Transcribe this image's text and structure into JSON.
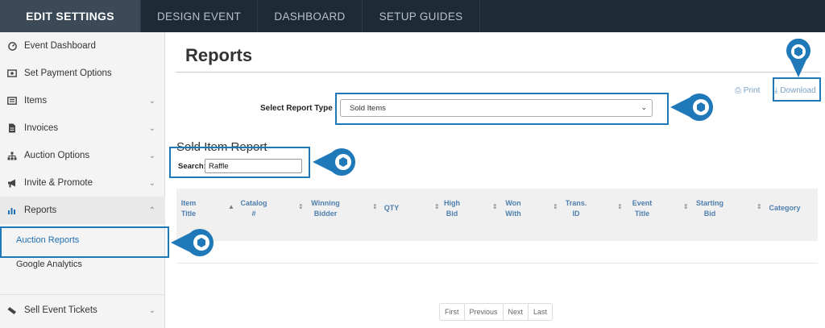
{
  "topnav": {
    "tabs": [
      {
        "label": "EDIT SETTINGS",
        "active": true
      },
      {
        "label": "DESIGN EVENT",
        "active": false
      },
      {
        "label": "DASHBOARD",
        "active": false
      },
      {
        "label": "SETUP GUIDES",
        "active": false
      }
    ]
  },
  "sidebar": {
    "items": [
      {
        "label": "Event Dashboard",
        "icon": "dashboard-icon"
      },
      {
        "label": "Set Payment Options",
        "icon": "money-icon"
      },
      {
        "label": "Items",
        "icon": "list-icon"
      },
      {
        "label": "Invoices",
        "icon": "document-icon"
      },
      {
        "label": "Auction Options",
        "icon": "sitemap-icon"
      },
      {
        "label": "Invite & Promote",
        "icon": "bullhorn-icon"
      },
      {
        "label": "Reports",
        "icon": "bar-chart-icon"
      },
      {
        "label": "Sell Event Tickets",
        "icon": "ticket-icon"
      }
    ],
    "sub_items": [
      {
        "label": "Auction Reports"
      },
      {
        "label": "Google Analytics"
      }
    ]
  },
  "main": {
    "title": "Reports",
    "print_label": "Print",
    "download_label": "Download",
    "report_type_label": "Select Report Type",
    "report_type_value": "Sold Items",
    "report_heading": "Sold Item Report",
    "search_label": "Search:",
    "search_value": "Raffle",
    "columns": [
      {
        "l1": "Item",
        "l2": "Title"
      },
      {
        "l1": "Catalog",
        "l2": "#"
      },
      {
        "l1": "Winning",
        "l2": "Bidder"
      },
      {
        "l1": "QTY",
        "l2": ""
      },
      {
        "l1": "High",
        "l2": "Bid"
      },
      {
        "l1": "Won",
        "l2": "With"
      },
      {
        "l1": "Trans.",
        "l2": "ID"
      },
      {
        "l1": "Event",
        "l2": "Title"
      },
      {
        "l1": "Starting",
        "l2": "Bid"
      },
      {
        "l1": "Category",
        "l2": ""
      }
    ],
    "pagination": [
      "First",
      "Previous",
      "Next",
      "Last"
    ]
  },
  "colors": {
    "nav_bg": "#1e2a35",
    "nav_active": "#3c4a57",
    "accent": "#1f78b8",
    "link": "#7aa0c4"
  }
}
